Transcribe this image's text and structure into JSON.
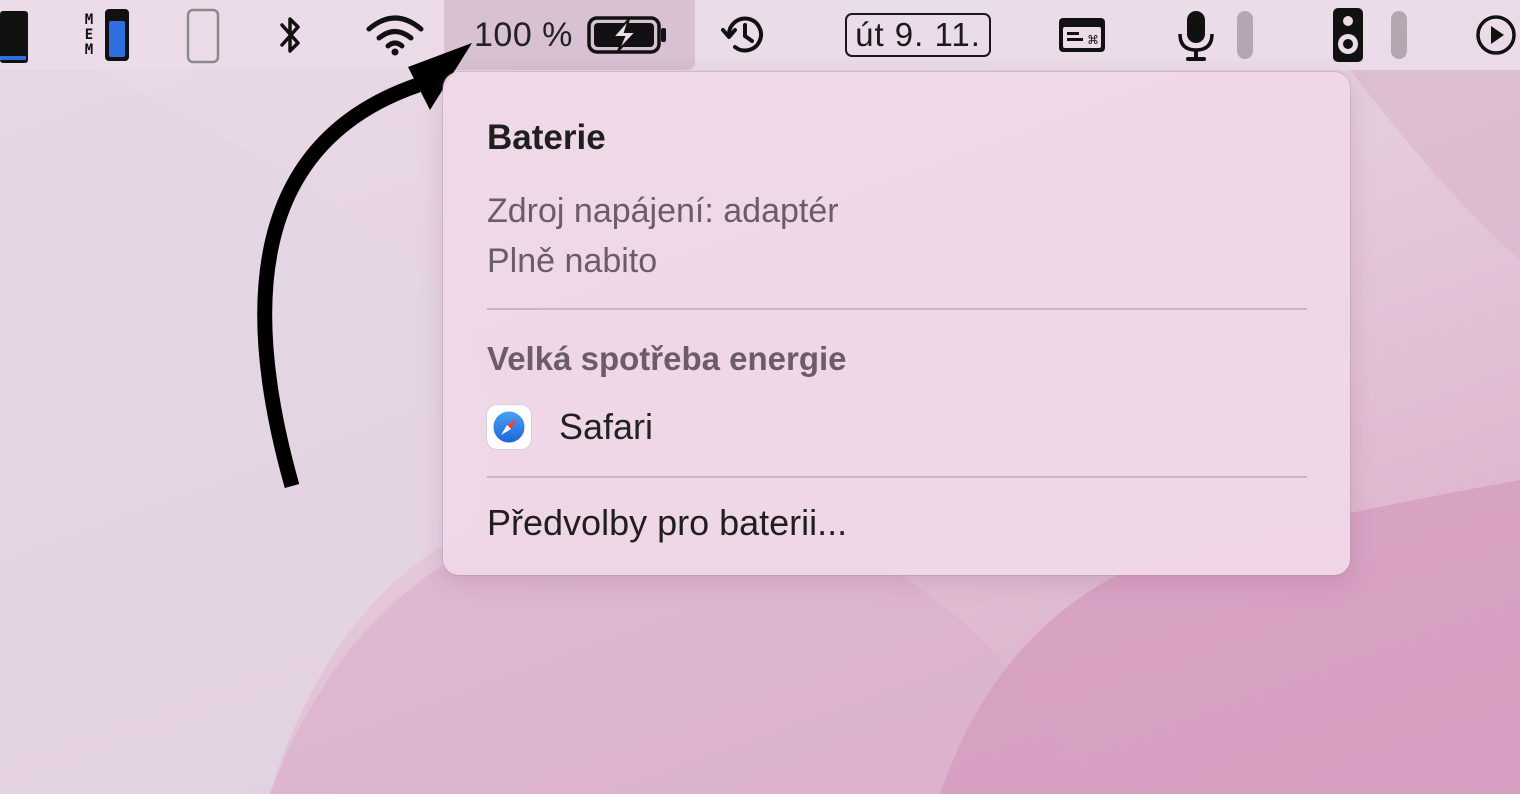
{
  "menubar": {
    "mem_label": [
      "M",
      "E",
      "M"
    ],
    "battery": {
      "percent": "100 %",
      "charging": true
    },
    "date": "út 9. 11."
  },
  "battery_menu": {
    "title": "Baterie",
    "power_source": "Zdroj napájení: adaptér",
    "status": "Plně nabito",
    "high_usage_header": "Velká spotřeba energie",
    "apps": [
      {
        "name": "Safari",
        "icon": "safari-icon"
      }
    ],
    "preferences_label": "Předvolby pro baterii..."
  },
  "colors": {
    "accent_blue": "#2f6fe0",
    "arrow": "#000000",
    "popup_bg": "#efd7e8"
  }
}
